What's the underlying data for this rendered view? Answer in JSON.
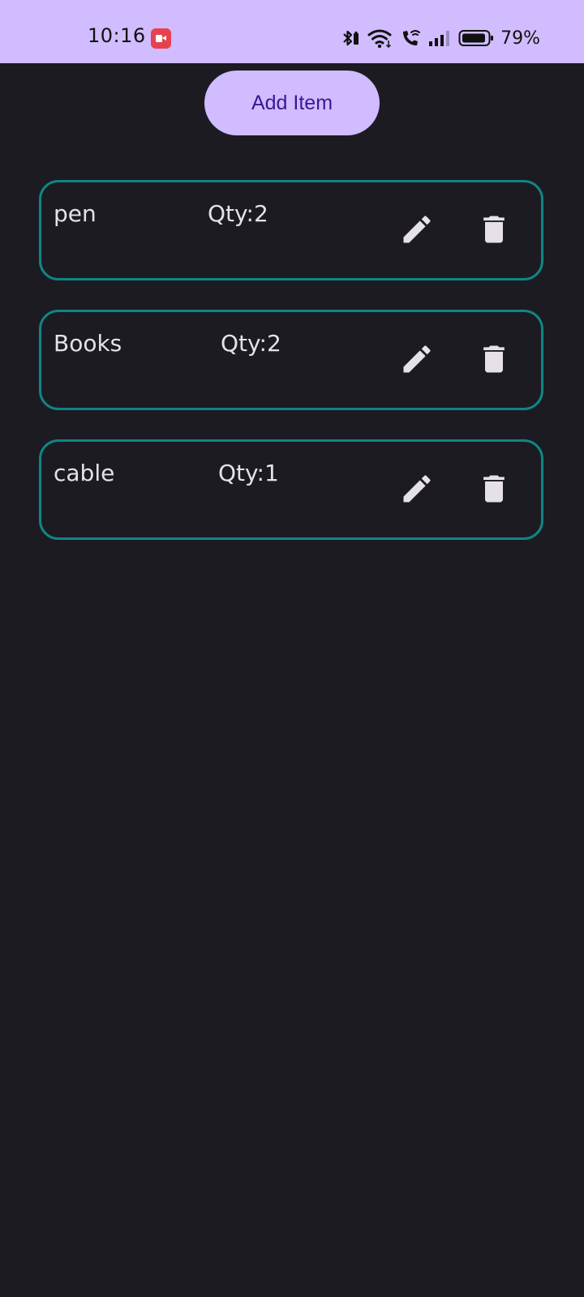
{
  "status_bar": {
    "time": "10:16",
    "battery": "79%",
    "icons": [
      "screen-record-icon",
      "bluetooth-icon",
      "wifi-icon",
      "wifi-calling-icon",
      "signal-icon",
      "battery-icon"
    ]
  },
  "toolbar": {
    "add_label": "Add Item"
  },
  "items": [
    {
      "name": "pen",
      "qty": "Qty:2"
    },
    {
      "name": "Books",
      "qty": "Qty:2"
    },
    {
      "name": "cable",
      "qty": "Qty:1"
    }
  ],
  "colors": {
    "background": "#1c1b22",
    "accent": "#d0bcff",
    "button_text": "#3a1796",
    "card_border": "#0f8684",
    "text": "#e6e1e9"
  },
  "item_icons": {
    "edit": "edit-pencil-icon",
    "delete": "trash-icon"
  }
}
